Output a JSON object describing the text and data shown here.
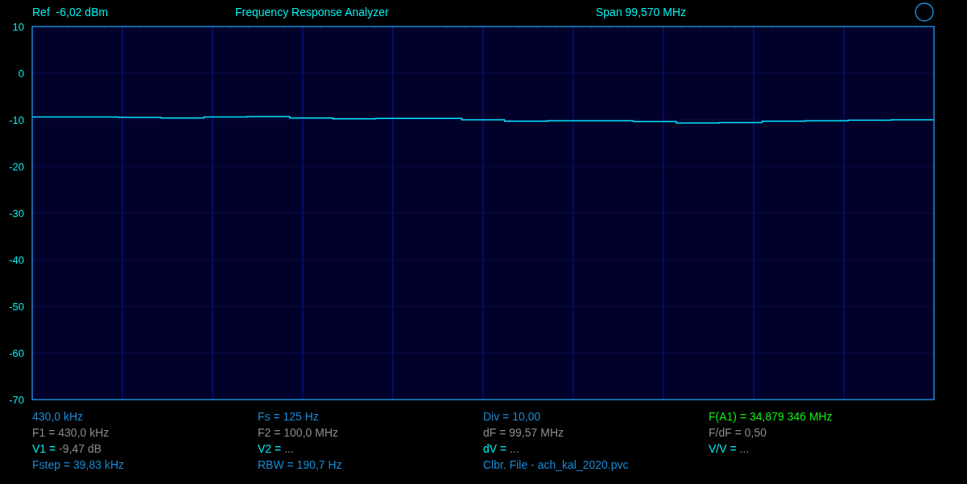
{
  "header": {
    "reference": "Ref  -6,02 dBm",
    "title": "Frequency Response Analyzer",
    "span": "Span 99,570 MHz"
  },
  "chart_data": {
    "type": "line",
    "grid": true,
    "ylim": [
      -70,
      10
    ],
    "yticks": [
      10,
      0,
      -10,
      -20,
      -30,
      -40,
      -50,
      -60,
      -70
    ],
    "series": [
      {
        "color": "#00e5ff",
        "values": [
          -9.4,
          -9.4,
          -9.5,
          -9.6,
          -9.4,
          -9.3,
          -9.6,
          -9.8,
          -9.7,
          -9.7,
          -10.0,
          -10.3,
          -10.2,
          -10.2,
          -10.4,
          -10.7,
          -10.6,
          -10.3,
          -10.2,
          -10.1,
          -10.0
        ]
      }
    ]
  },
  "info": [
    {
      "kind": "blue",
      "text": "430,0 kHz"
    },
    {
      "kind": "blue",
      "text": "Fs = 125 Hz"
    },
    {
      "kind": "blue",
      "text": "Div = 10,00"
    },
    {
      "kind": "green",
      "text": "F(A1) = 34,879 346 MHz"
    },
    {
      "kind": "grey",
      "text": "F1 = 430,0 kHz"
    },
    {
      "kind": "grey",
      "text": "F2 = 100,0 MHz"
    },
    {
      "kind": "grey",
      "text": "dF = 99,57 MHz"
    },
    {
      "kind": "grey",
      "text": "F/dF = 0,50"
    },
    {
      "kind": "mixed",
      "label": "V1 =",
      "value": "-9,47 dB"
    },
    {
      "kind": "mixed",
      "label": "V2 =",
      "value": "..."
    },
    {
      "kind": "mixed",
      "label": "dV =",
      "value": "..."
    },
    {
      "kind": "mixed",
      "label": "V/V =",
      "value": "..."
    },
    {
      "kind": "blue",
      "text": "Fstep = 39,83 kHz"
    },
    {
      "kind": "blue",
      "text": "RBW = 190,7 Hz"
    },
    {
      "kind": "blue",
      "text": "Clbr. File - ach_kal_2020.pvc"
    }
  ]
}
